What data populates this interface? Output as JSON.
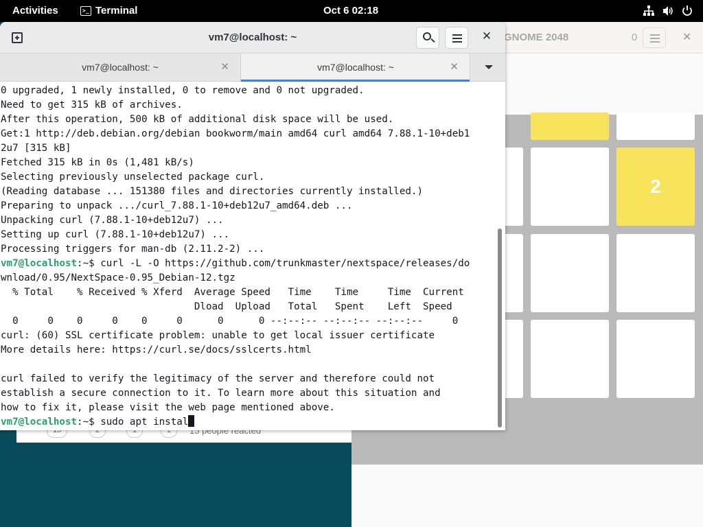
{
  "topbar": {
    "activities": "Activities",
    "app_name": "Terminal",
    "clock": "Oct 6  02:18",
    "tray_icons": [
      "network-icon",
      "volume-icon",
      "power-icon"
    ]
  },
  "background_window": {
    "reactions": [
      "15",
      "2",
      "1",
      "1"
    ],
    "reacted_text": "15 people reacted"
  },
  "game_window": {
    "title": "GNOME 2048",
    "score": "0",
    "tiles": [
      {
        "row": 0,
        "col": 1,
        "value": "",
        "color": "yellow"
      },
      {
        "row": 1,
        "col": 2,
        "value": "2",
        "color": "yellow"
      }
    ],
    "colors": {
      "tile_yellow": "#f8e45c",
      "board": "#bababa"
    }
  },
  "terminal": {
    "window_title": "vm7@localhost: ~",
    "tabs": [
      {
        "label": "vm7@localhost: ~",
        "active": false
      },
      {
        "label": "vm7@localhost: ~",
        "active": true
      }
    ],
    "lines": [
      "0 upgraded, 1 newly installed, 0 to remove and 0 not upgraded.",
      "Need to get 315 kB of archives.",
      "After this operation, 500 kB of additional disk space will be used.",
      "Get:1 http://deb.debian.org/debian bookworm/main amd64 curl amd64 7.88.1-10+deb1",
      "2u7 [315 kB]",
      "Fetched 315 kB in 0s (1,481 kB/s)",
      "Selecting previously unselected package curl.",
      "(Reading database ... 151380 files and directories currently installed.)",
      "Preparing to unpack .../curl_7.88.1-10+deb12u7_amd64.deb ...",
      "Unpacking curl (7.88.1-10+deb12u7) ...",
      "Setting up curl (7.88.1-10+deb12u7) ...",
      "Processing triggers for man-db (2.11.2-2) ..."
    ],
    "prompt1_user": "vm7@localhost",
    "prompt1_rest": ":~$ curl -L -O https://github.com/trunkmaster/nextspace/releases/do",
    "lines2": [
      "wnload/0.95/NextSpace-0.95_Debian-12.tgz",
      "  % Total    % Received % Xferd  Average Speed   Time    Time     Time  Current",
      "                                 Dload  Upload   Total   Spent    Left  Speed",
      "  0     0    0     0    0     0      0      0 --:--:-- --:--:-- --:--:--     0",
      "curl: (60) SSL certificate problem: unable to get local issuer certificate",
      "More details here: https://curl.se/docs/sslcerts.html",
      "",
      "curl failed to verify the legitimacy of the server and therefore could not",
      "establish a secure connection to it. To learn more about this situation and",
      "how to fix it, please visit the web page mentioned above."
    ],
    "prompt2_user": "vm7@localhost",
    "prompt2_rest": ":~$ sudo apt instal",
    "colors": {
      "prompt": "#26a269",
      "text": "#171421",
      "tab_accent": "#3584e4"
    }
  }
}
